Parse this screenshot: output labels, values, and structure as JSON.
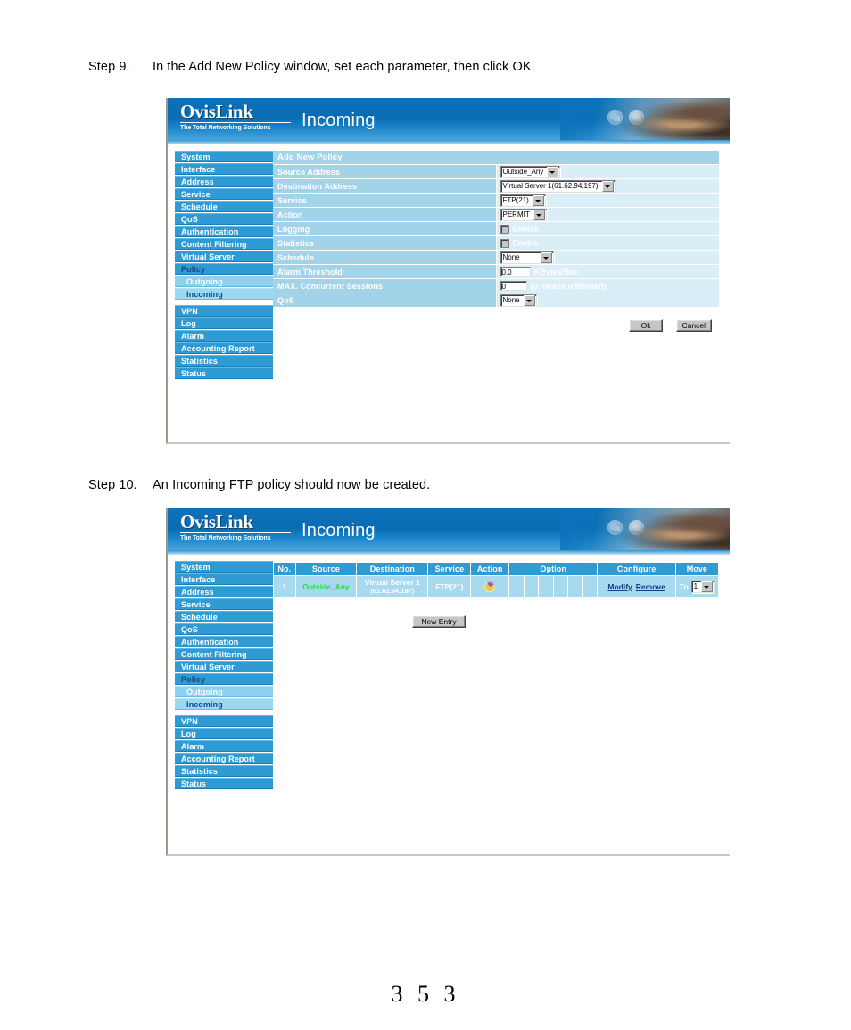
{
  "document": {
    "page_number": "3 5 3",
    "steps": [
      {
        "label": "Step 9.",
        "text": "In the Add New Policy window, set each parameter, then click OK."
      },
      {
        "label": "Step 10.",
        "text": "An Incoming FTP policy should now be created."
      }
    ]
  },
  "app": {
    "brand_name": "OvisLink",
    "brand_tagline": "The Total Networking Solutions",
    "page_title": "Incoming",
    "icons": {
      "globe1": "globe-icon",
      "globe2": "globe-icon"
    }
  },
  "sidebar": {
    "items": [
      {
        "label": "System",
        "level": "main",
        "active": false
      },
      {
        "label": "Interface",
        "level": "main",
        "active": false
      },
      {
        "label": "Address",
        "level": "main",
        "active": false
      },
      {
        "label": "Service",
        "level": "main",
        "active": false
      },
      {
        "label": "Schedule",
        "level": "main",
        "active": false
      },
      {
        "label": "QoS",
        "level": "main",
        "active": false
      },
      {
        "label": "Authentication",
        "level": "main",
        "active": false
      },
      {
        "label": "Content Filtering",
        "level": "main",
        "active": false
      },
      {
        "label": "Virtual Server",
        "level": "main",
        "active": false
      },
      {
        "label": "Policy",
        "level": "main",
        "active": true
      },
      {
        "label": "Outgoing",
        "level": "sub",
        "active": false
      },
      {
        "label": "Incoming",
        "level": "sub",
        "active": true
      },
      {
        "label": "VPN",
        "level": "main",
        "active": false
      },
      {
        "label": "Log",
        "level": "main",
        "active": false
      },
      {
        "label": "Alarm",
        "level": "main",
        "active": false
      },
      {
        "label": "Accounting Report",
        "level": "main",
        "active": false
      },
      {
        "label": "Statistics",
        "level": "main",
        "active": false
      },
      {
        "label": "Status",
        "level": "main",
        "active": false
      }
    ]
  },
  "add_policy_form": {
    "title": "Add New Policy",
    "fields": {
      "source_address": {
        "label": "Source Address",
        "value": "Outside_Any"
      },
      "destination": {
        "label": "Destination Address",
        "value": "Virtual Server 1(61.62.94.197)"
      },
      "service": {
        "label": "Service",
        "value": "FTP(21)"
      },
      "action": {
        "label": "Action",
        "value": "PERMIT"
      },
      "logging": {
        "label": "Logging",
        "checkbox_label": "Enable",
        "checked": false
      },
      "statistics": {
        "label": "Statistics",
        "checkbox_label": "Enable",
        "checked": false
      },
      "schedule": {
        "label": "Schedule",
        "value": "None"
      },
      "alarm_threshold": {
        "label": "Alarm Threshold",
        "value": "0.0",
        "unit": "KBytes/Sec"
      },
      "max_sessions": {
        "label": "MAX. Concurrent Sessions",
        "value": "0",
        "unit": "(0:means unlimited)"
      },
      "qos": {
        "label": "QoS",
        "value": "None"
      }
    },
    "buttons": {
      "ok": "Ok",
      "cancel": "Cancel"
    }
  },
  "policy_list": {
    "columns": [
      "No.",
      "Source",
      "Destination",
      "Service",
      "Action",
      "Option",
      "Configure",
      "Move"
    ],
    "rows": [
      {
        "no": "1",
        "source": "Outside_Any",
        "destination_name": "Virtual Server 1",
        "destination_ip": "(61.62.94.197)",
        "service": "FTP(21)",
        "action_icon": "permit-icon",
        "modify": "Modify",
        "remove": "Remove",
        "move_to_label": "To",
        "move_to_value": "1"
      }
    ],
    "new_entry_button": "New Entry"
  },
  "colors": {
    "header_blue": "#0d72b9",
    "nav_blue": "#2e9bd4",
    "nav_sub_blue": "#8ed0ef",
    "label_cell": "#a3d3e9",
    "value_cell": "#d9eef7",
    "row_cell": "#a9d9ef",
    "source_green": "#27e03c",
    "link_blue": "#11407e"
  }
}
